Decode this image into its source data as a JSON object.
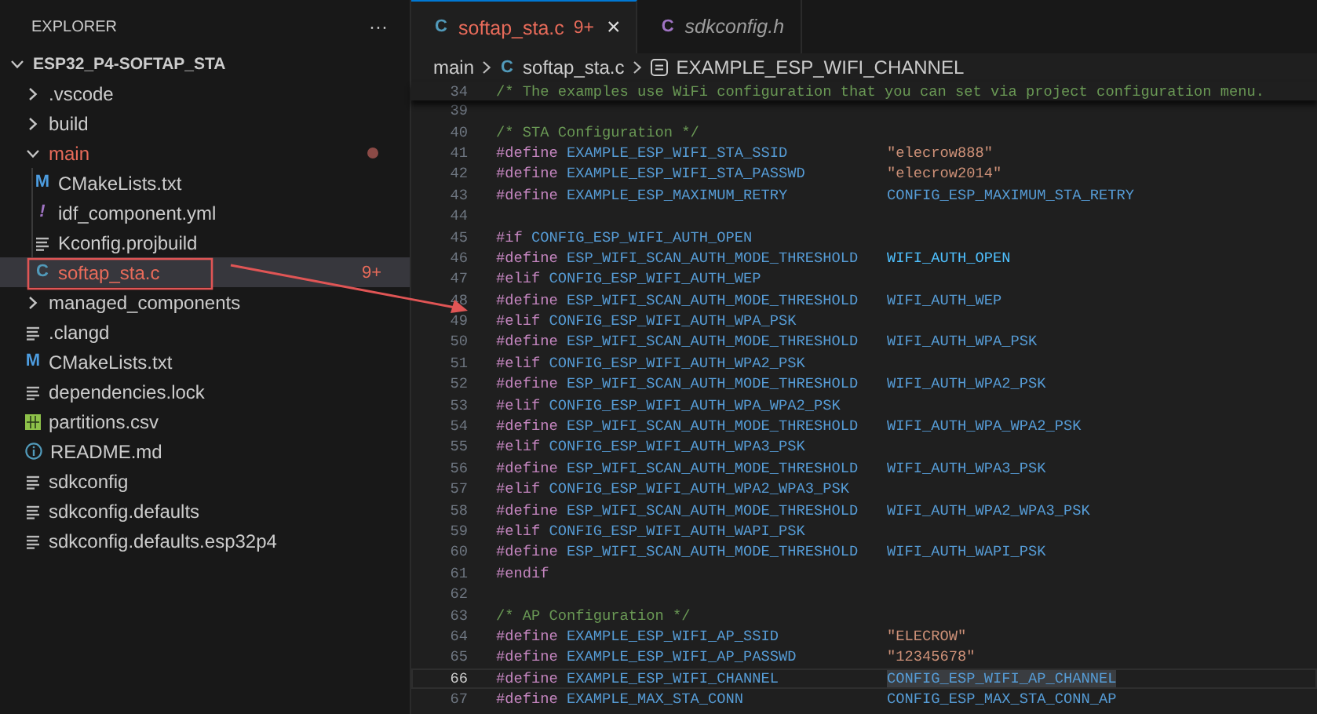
{
  "sidebar": {
    "title": "EXPLORER",
    "more": "···",
    "tree": [
      {
        "label": "ESP32_P4-SOFTAP_STA",
        "kind": "folder",
        "expanded": true,
        "selected": false,
        "modified": false,
        "children": [
          {
            "label": ".vscode",
            "kind": "folder",
            "expanded": false,
            "selected": false,
            "modified": false
          },
          {
            "label": "build",
            "kind": "folder",
            "expanded": false,
            "selected": false,
            "modified": false
          },
          {
            "label": "main",
            "kind": "folder",
            "expanded": true,
            "selected": false,
            "modified": true,
            "children": [
              {
                "label": "CMakeLists.txt",
                "kind": "cmake",
                "glyph": "M",
                "selected": false,
                "modified": false
              },
              {
                "label": "idf_component.yml",
                "kind": "yaml",
                "glyph": "!",
                "selected": false,
                "modified": false
              },
              {
                "label": "Kconfig.projbuild",
                "kind": "lines",
                "selected": false,
                "modified": false
              },
              {
                "label": "softap_sta.c",
                "kind": "c",
                "glyph": "C",
                "selected": true,
                "modified": true,
                "badge": "9+"
              }
            ]
          },
          {
            "label": "managed_components",
            "kind": "folder",
            "expanded": false,
            "selected": false,
            "modified": false
          },
          {
            "label": ".clangd",
            "kind": "lines",
            "selected": false,
            "modified": false
          },
          {
            "label": "CMakeLists.txt",
            "kind": "cmake",
            "glyph": "M",
            "selected": false,
            "modified": false
          },
          {
            "label": "dependencies.lock",
            "kind": "lines",
            "selected": false,
            "modified": false
          },
          {
            "label": "partitions.csv",
            "kind": "csv",
            "selected": false,
            "modified": false
          },
          {
            "label": "README.md",
            "kind": "info",
            "selected": false,
            "modified": false
          },
          {
            "label": "sdkconfig",
            "kind": "lines",
            "selected": false,
            "modified": false
          },
          {
            "label": "sdkconfig.defaults",
            "kind": "lines",
            "selected": false,
            "modified": false
          },
          {
            "label": "sdkconfig.defaults.esp32p4",
            "kind": "lines",
            "selected": false,
            "modified": false
          }
        ]
      }
    ]
  },
  "tabs": [
    {
      "label": "softap_sta.c",
      "kind": "c",
      "glyph": "C",
      "badge": "9+",
      "close": "×",
      "selected": true,
      "modified": true,
      "preview": false
    },
    {
      "label": "sdkconfig.h",
      "kind": "h",
      "glyph": "C",
      "selected": false,
      "modified": false,
      "preview": true
    }
  ],
  "breadcrumb": [
    {
      "label": "main"
    },
    {
      "label": "softap_sta.c",
      "kind": "c",
      "glyph": "C"
    },
    {
      "label": "EXAMPLE_ESP_WIFI_CHANNEL",
      "kind": "constant"
    }
  ],
  "sticky_line": {
    "number": "34",
    "comment": "/* The examples use WiFi configuration that you can set via project configuration menu."
  },
  "code_lines": [
    {
      "number": "39",
      "current": false
    },
    {
      "number": "40",
      "current": false,
      "comment": "/* STA Configuration */"
    },
    {
      "number": "41",
      "current": false,
      "directive": "#define",
      "name": "EXAMPLE_ESP_WIFI_STA_SSID",
      "value": {
        "text": "\"elecrow888\"",
        "kind": "string"
      }
    },
    {
      "number": "42",
      "current": false,
      "directive": "#define",
      "name": "EXAMPLE_ESP_WIFI_STA_PASSWD",
      "value": {
        "text": "\"elecrow2014\"",
        "kind": "string"
      }
    },
    {
      "number": "43",
      "current": false,
      "directive": "#define",
      "name": "EXAMPLE_ESP_MAXIMUM_RETRY",
      "value": {
        "text": "CONFIG_ESP_MAXIMUM_STA_RETRY",
        "kind": "macro"
      }
    },
    {
      "number": "44",
      "current": false
    },
    {
      "number": "45",
      "current": false,
      "directive": "#if",
      "name": "CONFIG_ESP_WIFI_AUTH_OPEN"
    },
    {
      "number": "46",
      "current": false,
      "directive": "#define",
      "name": "ESP_WIFI_SCAN_AUTH_MODE_THRESHOLD",
      "value": {
        "text": "WIFI_AUTH_OPEN",
        "kind": "constant"
      }
    },
    {
      "number": "47",
      "current": false,
      "directive": "#elif",
      "name": "CONFIG_ESP_WIFI_AUTH_WEP"
    },
    {
      "number": "48",
      "current": false,
      "directive": "#define",
      "name": "ESP_WIFI_SCAN_AUTH_MODE_THRESHOLD",
      "value": {
        "text": "WIFI_AUTH_WEP",
        "kind": "macro"
      }
    },
    {
      "number": "49",
      "current": false,
      "directive": "#elif",
      "name": "CONFIG_ESP_WIFI_AUTH_WPA_PSK"
    },
    {
      "number": "50",
      "current": false,
      "directive": "#define",
      "name": "ESP_WIFI_SCAN_AUTH_MODE_THRESHOLD",
      "value": {
        "text": "WIFI_AUTH_WPA_PSK",
        "kind": "macro"
      }
    },
    {
      "number": "51",
      "current": false,
      "directive": "#elif",
      "name": "CONFIG_ESP_WIFI_AUTH_WPA2_PSK"
    },
    {
      "number": "52",
      "current": false,
      "directive": "#define",
      "name": "ESP_WIFI_SCAN_AUTH_MODE_THRESHOLD",
      "value": {
        "text": "WIFI_AUTH_WPA2_PSK",
        "kind": "macro"
      }
    },
    {
      "number": "53",
      "current": false,
      "directive": "#elif",
      "name": "CONFIG_ESP_WIFI_AUTH_WPA_WPA2_PSK"
    },
    {
      "number": "54",
      "current": false,
      "directive": "#define",
      "name": "ESP_WIFI_SCAN_AUTH_MODE_THRESHOLD",
      "value": {
        "text": "WIFI_AUTH_WPA_WPA2_PSK",
        "kind": "macro"
      }
    },
    {
      "number": "55",
      "current": false,
      "directive": "#elif",
      "name": "CONFIG_ESP_WIFI_AUTH_WPA3_PSK"
    },
    {
      "number": "56",
      "current": false,
      "directive": "#define",
      "name": "ESP_WIFI_SCAN_AUTH_MODE_THRESHOLD",
      "value": {
        "text": "WIFI_AUTH_WPA3_PSK",
        "kind": "macro"
      }
    },
    {
      "number": "57",
      "current": false,
      "directive": "#elif",
      "name": "CONFIG_ESP_WIFI_AUTH_WPA2_WPA3_PSK"
    },
    {
      "number": "58",
      "current": false,
      "directive": "#define",
      "name": "ESP_WIFI_SCAN_AUTH_MODE_THRESHOLD",
      "value": {
        "text": "WIFI_AUTH_WPA2_WPA3_PSK",
        "kind": "macro"
      }
    },
    {
      "number": "59",
      "current": false,
      "directive": "#elif",
      "name": "CONFIG_ESP_WIFI_AUTH_WAPI_PSK"
    },
    {
      "number": "60",
      "current": false,
      "directive": "#define",
      "name": "ESP_WIFI_SCAN_AUTH_MODE_THRESHOLD",
      "value": {
        "text": "WIFI_AUTH_WAPI_PSK",
        "kind": "macro"
      }
    },
    {
      "number": "61",
      "current": false,
      "directive": "#endif"
    },
    {
      "number": "62",
      "current": false
    },
    {
      "number": "63",
      "current": false,
      "comment": "/* AP Configuration */"
    },
    {
      "number": "64",
      "current": false,
      "directive": "#define",
      "name": "EXAMPLE_ESP_WIFI_AP_SSID",
      "value": {
        "text": "\"ELECROW\"",
        "kind": "string"
      }
    },
    {
      "number": "65",
      "current": false,
      "directive": "#define",
      "name": "EXAMPLE_ESP_WIFI_AP_PASSWD",
      "value": {
        "text": "\"12345678\"",
        "kind": "string"
      }
    },
    {
      "number": "66",
      "current": true,
      "directive": "#define",
      "name": "EXAMPLE_ESP_WIFI_CHANNEL",
      "value": {
        "text": "CONFIG_ESP_WIFI_AP_CHANNEL",
        "kind": "macro"
      }
    },
    {
      "number": "67",
      "current": false,
      "directive": "#define",
      "name": "EXAMPLE_MAX_STA_CONN",
      "value": {
        "text": "CONFIG_ESP_MAX_STA_CONN_AP",
        "kind": "macro"
      }
    }
  ]
}
